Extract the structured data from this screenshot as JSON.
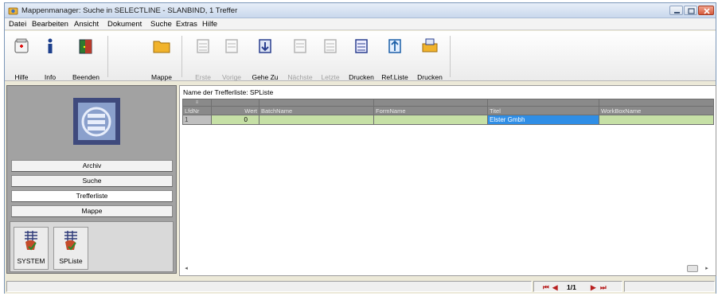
{
  "window": {
    "title": "Mappenmanager: Suche in SELECTLINE - SLANBIND, 1 Treffer",
    "controls": [
      "minimize-icon",
      "maximize-icon",
      "close-icon"
    ]
  },
  "menu": [
    "Datei",
    "Bearbeiten",
    "Ansicht",
    "Dokument",
    "Suche",
    "Extras",
    "Hilfe"
  ],
  "toolbar": {
    "hilfe": "Hilfe",
    "info": "Info",
    "beenden": "Beenden",
    "mappe": "Mappe",
    "erste": "Erste",
    "vorige": "Vorige",
    "gehezu": "Gehe Zu",
    "naechste": "Nächste",
    "letzte": "Letzte",
    "drucken1": "Drucken",
    "refliste": "Ref.Liste",
    "drucken2": "Drucken"
  },
  "nav": {
    "archiv": "Archiv",
    "suche": "Suche",
    "trefferliste": "Trefferliste",
    "mappe": "Mappe"
  },
  "shortcuts": {
    "system": "SYSTEM",
    "spliste": "SPListe"
  },
  "list": {
    "name_label": "Name der Trefferliste: SPListe",
    "corner_marker": "≡",
    "columns": [
      "LfdNr",
      "Wert",
      "BatchName",
      "FormName",
      "Titel",
      "WorkBoxName"
    ],
    "rows": [
      {
        "lfdnr": "1",
        "wert": "0",
        "batchname": "",
        "formname": "",
        "titel": "Elster Gmbh",
        "workboxname": ""
      }
    ]
  },
  "status": {
    "pager_first": "⏮",
    "pager_prev": "◀",
    "page": "1/1",
    "pager_next": "▶",
    "pager_last": "⏭"
  },
  "colors": {
    "row_highlight": "#c6e0a6",
    "selection": "#2f8ee6",
    "header_gray": "#8a8a8a"
  }
}
